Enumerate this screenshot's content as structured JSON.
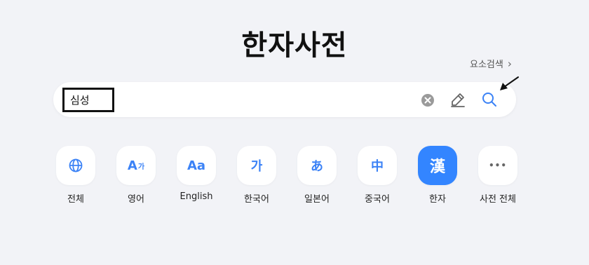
{
  "title": "한자사전",
  "advanced_search": {
    "label": "요소검색",
    "chevron": "›"
  },
  "search": {
    "value": "심성"
  },
  "categories": [
    {
      "label": "전체",
      "icon": "globe-icon",
      "glyph": ""
    },
    {
      "label": "영어",
      "icon": "english-korean-icon",
      "glyph": "A",
      "glyph_small": "가"
    },
    {
      "label": "English",
      "icon": "english-icon",
      "glyph": "Aa"
    },
    {
      "label": "한국어",
      "icon": "korean-icon",
      "glyph": "가"
    },
    {
      "label": "일본어",
      "icon": "japanese-icon",
      "glyph": "あ"
    },
    {
      "label": "중국어",
      "icon": "chinese-icon",
      "glyph": "中"
    },
    {
      "label": "한자",
      "icon": "hanja-icon",
      "glyph": "漢",
      "active": true
    },
    {
      "label": "사전 전체",
      "icon": "more-icon",
      "glyph": "•••"
    }
  ],
  "colors": {
    "accent": "#3385ff",
    "icon_blue": "#3b82f6",
    "background": "#f2f3f7"
  }
}
